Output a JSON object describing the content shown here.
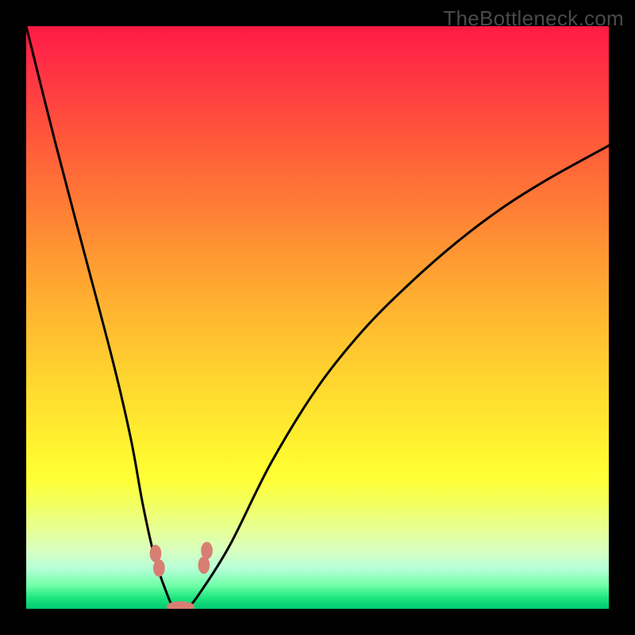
{
  "watermark": {
    "text": "TheBottleneck.com"
  },
  "chart_data": {
    "type": "line",
    "title": "",
    "xlabel": "",
    "ylabel": "",
    "xlim": [
      0,
      100
    ],
    "ylim": [
      0,
      100
    ],
    "series": [
      {
        "name": "bottleneck-curve",
        "x": [
          0,
          5,
          10,
          15,
          18,
          20,
          22,
          24,
          25.5,
          27.5,
          30,
          35,
          42,
          50,
          58,
          66,
          74,
          82,
          90,
          100
        ],
        "values": [
          100,
          80,
          61,
          42,
          29,
          18,
          9,
          3,
          0,
          0,
          3,
          11,
          25,
          38,
          48,
          56,
          63,
          69,
          74,
          79.5
        ]
      }
    ],
    "markers": [
      {
        "name": "left-knee-marker",
        "x": 22.2,
        "y": 9.5,
        "rx": 1.0,
        "ry": 1.5
      },
      {
        "name": "left-knee-marker-2",
        "x": 22.8,
        "y": 7.0,
        "rx": 1.0,
        "ry": 1.5
      },
      {
        "name": "bottom-marker",
        "x": 26.5,
        "y": 0.4,
        "rx": 2.4,
        "ry": 0.9
      },
      {
        "name": "right-knee-marker",
        "x": 30.5,
        "y": 7.5,
        "rx": 1.0,
        "ry": 1.5
      },
      {
        "name": "right-knee-marker-2",
        "x": 31.0,
        "y": 10.0,
        "rx": 1.0,
        "ry": 1.5
      }
    ],
    "gradient_stops": [
      {
        "pct": 0,
        "color": "#ff1a45"
      },
      {
        "pct": 50,
        "color": "#ffb830"
      },
      {
        "pct": 78,
        "color": "#ffff38"
      },
      {
        "pct": 100,
        "color": "#00c870"
      }
    ]
  }
}
